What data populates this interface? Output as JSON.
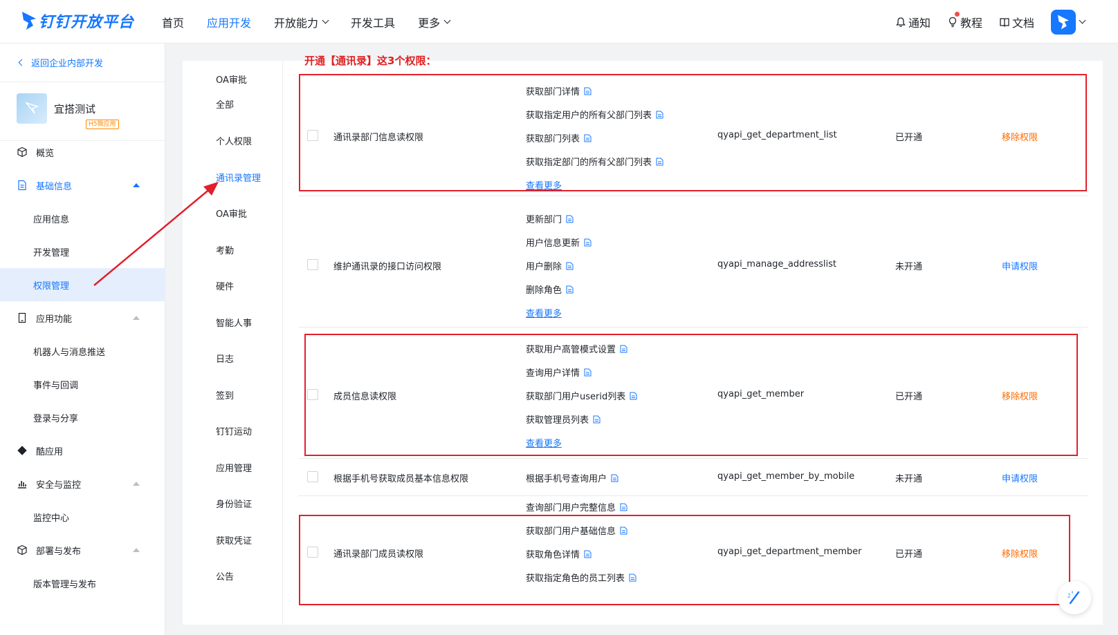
{
  "topbar": {
    "brand": "钉钉开放平台",
    "nav": [
      {
        "label": "首页",
        "active": false,
        "dropdown": false
      },
      {
        "label": "应用开发",
        "active": true,
        "dropdown": false
      },
      {
        "label": "开放能力",
        "active": false,
        "dropdown": true
      },
      {
        "label": "开发工具",
        "active": false,
        "dropdown": false
      },
      {
        "label": "更多",
        "active": false,
        "dropdown": true
      }
    ],
    "notify": "通知",
    "tutorial": "教程",
    "docs": "文档"
  },
  "sidebar": {
    "back": "返回企业内部开发",
    "app_name": "宜搭测试",
    "app_tag": "H5微应用",
    "items": [
      {
        "label": "概览",
        "icon": "cube-icon",
        "sub": false
      },
      {
        "label": "基础信息",
        "icon": "file-icon",
        "sub": false,
        "expanded": true
      },
      {
        "label": "应用信息",
        "sub": true
      },
      {
        "label": "开发管理",
        "sub": true
      },
      {
        "label": "权限管理",
        "sub": true,
        "selected": true
      },
      {
        "label": "应用功能",
        "icon": "phone-icon",
        "sub": false
      },
      {
        "label": "机器人与消息推送",
        "sub": true
      },
      {
        "label": "事件与回调",
        "sub": true
      },
      {
        "label": "登录与分享",
        "sub": true
      },
      {
        "label": "酷应用",
        "icon": "cool-app-icon",
        "sub": false
      },
      {
        "label": "安全与监控",
        "icon": "chart-icon",
        "sub": false
      },
      {
        "label": "监控中心",
        "sub": true
      },
      {
        "label": "部署与发布",
        "icon": "box-icon",
        "sub": false
      },
      {
        "label": "版本管理与发布",
        "sub": true
      }
    ]
  },
  "categories": [
    "OA审批",
    "全部",
    "个人权限",
    "通讯录管理",
    "OA审批",
    "考勤",
    "硬件",
    "智能人事",
    "日志",
    "签到",
    "钉钉运动",
    "应用管理",
    "身份验证",
    "获取凭证",
    "公告"
  ],
  "active_category": "通讯录管理",
  "annotation": "开通【通讯录】这3个权限：",
  "permissions": [
    {
      "name": "通讯录部门信息读权限",
      "apis": [
        "获取部门详情",
        "获取指定用户的所有父部门列表",
        "获取部门列表",
        "获取指定部门的所有父部门列表"
      ],
      "more": "查看更多",
      "code": "qyapi_get_department_list",
      "status": "已开通",
      "action": "移除权限"
    },
    {
      "name": "维护通讯录的接口访问权限",
      "apis": [
        "更新部门",
        "用户信息更新",
        "用户删除",
        "删除角色"
      ],
      "more": "查看更多",
      "code": "qyapi_manage_addresslist",
      "status": "未开通",
      "action": "申请权限"
    },
    {
      "name": "成员信息读权限",
      "apis": [
        "获取用户高管模式设置",
        "查询用户详情",
        "获取部门用户userid列表",
        "获取管理员列表"
      ],
      "more": "查看更多",
      "code": "qyapi_get_member",
      "status": "已开通",
      "action": "移除权限"
    },
    {
      "name": "根据手机号获取成员基本信息权限",
      "apis": [
        "根据手机号查询用户"
      ],
      "more": "",
      "code": "qyapi_get_member_by_mobile",
      "status": "未开通",
      "action": "申请权限"
    },
    {
      "name": "通讯录部门成员读权限",
      "apis": [
        "查询部门用户完整信息",
        "获取部门用户基础信息",
        "获取角色详情",
        "获取指定角色的员工列表"
      ],
      "more": "",
      "code": "qyapi_get_department_member",
      "status": "已开通",
      "action": "移除权限"
    }
  ],
  "colors": {
    "accent": "#1677ff",
    "remove": "#ff6a00",
    "annotation": "#e02020"
  }
}
